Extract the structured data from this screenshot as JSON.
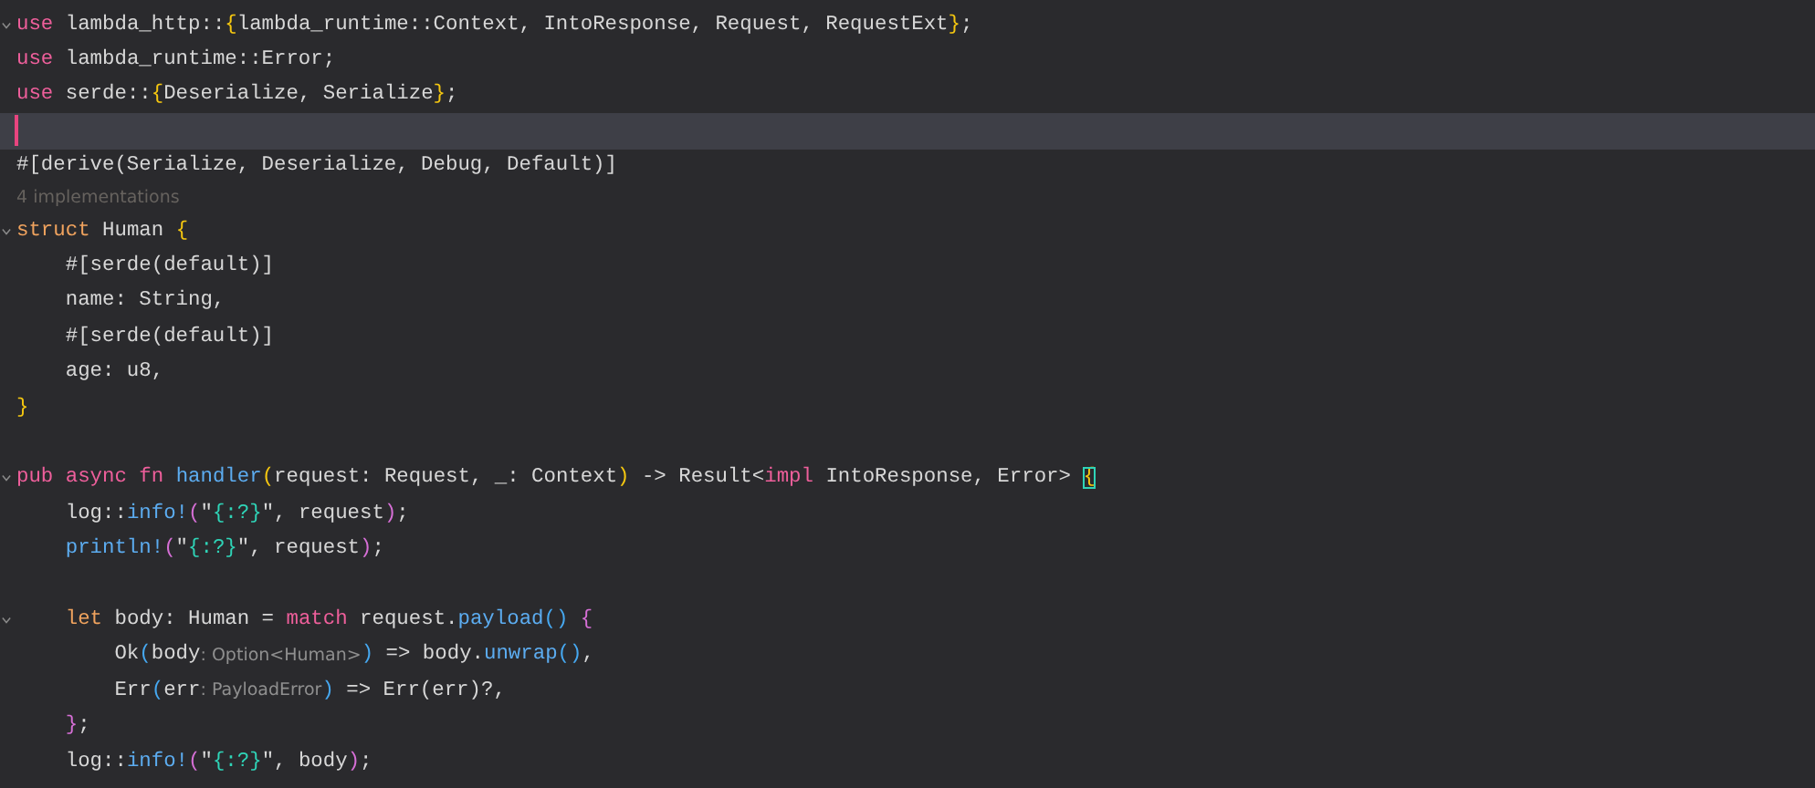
{
  "editor": {
    "lines": [
      {
        "kind": "code",
        "foldable": true,
        "current": false,
        "tokens": [
          {
            "text": "use",
            "kind": "keyword"
          },
          {
            "text": " lambda_http::",
            "kind": "plain"
          },
          {
            "text": "{",
            "kind": "bracket-yellow"
          },
          {
            "text": "lambda_runtime::Context, IntoResponse, Request, RequestExt",
            "kind": "plain"
          },
          {
            "text": "}",
            "kind": "bracket-yellow"
          },
          {
            "text": ";",
            "kind": "plain"
          }
        ]
      },
      {
        "kind": "code",
        "foldable": false,
        "current": false,
        "tokens": [
          {
            "text": "use",
            "kind": "keyword"
          },
          {
            "text": " lambda_runtime::Error;",
            "kind": "plain"
          }
        ]
      },
      {
        "kind": "code",
        "foldable": false,
        "current": false,
        "tokens": [
          {
            "text": "use",
            "kind": "keyword"
          },
          {
            "text": " serde::",
            "kind": "plain"
          },
          {
            "text": "{",
            "kind": "bracket-yellow"
          },
          {
            "text": "Deserialize, Serialize",
            "kind": "plain"
          },
          {
            "text": "}",
            "kind": "bracket-yellow"
          },
          {
            "text": ";",
            "kind": "plain"
          }
        ]
      },
      {
        "kind": "code",
        "foldable": false,
        "current": true
      },
      {
        "kind": "code",
        "foldable": false,
        "current": false,
        "tokens": [
          {
            "text": "#[derive(Serialize, Deserialize, Debug, Default)]",
            "kind": "plain"
          }
        ]
      },
      {
        "kind": "lens",
        "text": "4 implementations"
      },
      {
        "kind": "code",
        "foldable": true,
        "current": false,
        "tokens": [
          {
            "text": "struct",
            "kind": "declaration"
          },
          {
            "text": " Human ",
            "kind": "plain"
          },
          {
            "text": "{",
            "kind": "bracket-yellow"
          }
        ]
      },
      {
        "kind": "code",
        "foldable": false,
        "current": false,
        "tokens": [
          {
            "text": "    #[serde(default)]",
            "kind": "plain"
          }
        ]
      },
      {
        "kind": "code",
        "foldable": false,
        "current": false,
        "tokens": [
          {
            "text": "    name: String,",
            "kind": "plain"
          }
        ]
      },
      {
        "kind": "code",
        "foldable": false,
        "current": false,
        "tokens": [
          {
            "text": "    #[serde(default)]",
            "kind": "plain"
          }
        ]
      },
      {
        "kind": "code",
        "foldable": false,
        "current": false,
        "tokens": [
          {
            "text": "    age: u8,",
            "kind": "plain"
          }
        ]
      },
      {
        "kind": "code",
        "foldable": false,
        "current": false,
        "tokens": [
          {
            "text": "}",
            "kind": "bracket-yellow"
          }
        ]
      },
      {
        "kind": "code",
        "foldable": false,
        "current": false
      },
      {
        "kind": "code",
        "foldable": true,
        "current": false,
        "tokens": [
          {
            "text": "pub ",
            "kind": "keyword"
          },
          {
            "text": "async ",
            "kind": "keyword"
          },
          {
            "text": "fn ",
            "kind": "keyword"
          },
          {
            "text": "handler",
            "kind": "function"
          },
          {
            "text": "(",
            "kind": "bracket-yellow"
          },
          {
            "text": "request: Request, _: Context",
            "kind": "plain"
          },
          {
            "text": ")",
            "kind": "bracket-yellow"
          },
          {
            "text": " -> Result<",
            "kind": "plain"
          },
          {
            "text": "impl",
            "kind": "keyword"
          },
          {
            "text": " IntoResponse, Error> ",
            "kind": "plain"
          },
          {
            "text": "{",
            "kind": "bracket-matched"
          }
        ]
      },
      {
        "kind": "code",
        "foldable": false,
        "current": false,
        "tokens": [
          {
            "text": "    log::",
            "kind": "plain"
          },
          {
            "text": "info!",
            "kind": "function"
          },
          {
            "text": "(",
            "kind": "bracket-pink"
          },
          {
            "text": "\"",
            "kind": "plain"
          },
          {
            "text": "{:?}",
            "kind": "string"
          },
          {
            "text": "\", request",
            "kind": "plain"
          },
          {
            "text": ")",
            "kind": "bracket-pink"
          },
          {
            "text": ";",
            "kind": "plain"
          }
        ]
      },
      {
        "kind": "code",
        "foldable": false,
        "current": false,
        "tokens": [
          {
            "text": "    println!",
            "kind": "function"
          },
          {
            "text": "(",
            "kind": "bracket-pink"
          },
          {
            "text": "\"",
            "kind": "plain"
          },
          {
            "text": "{:?}",
            "kind": "string"
          },
          {
            "text": "\", request",
            "kind": "plain"
          },
          {
            "text": ")",
            "kind": "bracket-pink"
          },
          {
            "text": ";",
            "kind": "plain"
          }
        ]
      },
      {
        "kind": "code",
        "foldable": false,
        "current": false
      },
      {
        "kind": "code",
        "foldable": true,
        "current": false,
        "tokens": [
          {
            "text": "    let",
            "kind": "declaration"
          },
          {
            "text": " body: Human = ",
            "kind": "plain"
          },
          {
            "text": "match",
            "kind": "keyword"
          },
          {
            "text": " request.",
            "kind": "plain"
          },
          {
            "text": "payload",
            "kind": "function"
          },
          {
            "text": "()",
            "kind": "bracket-blue"
          },
          {
            "text": " {",
            "kind": "bracket-pink"
          }
        ]
      },
      {
        "kind": "code",
        "foldable": false,
        "current": false,
        "tokens": [
          {
            "text": "        Ok",
            "kind": "plain"
          },
          {
            "text": "(",
            "kind": "bracket-blue"
          },
          {
            "text": "body",
            "kind": "plain"
          },
          {
            "text": ": Option<Human>",
            "kind": "hint"
          },
          {
            "text": ")",
            "kind": "bracket-blue"
          },
          {
            "text": " => body.",
            "kind": "plain"
          },
          {
            "text": "unwrap",
            "kind": "function"
          },
          {
            "text": "()",
            "kind": "bracket-blue"
          },
          {
            "text": ",",
            "kind": "plain"
          }
        ]
      },
      {
        "kind": "code",
        "foldable": false,
        "current": false,
        "tokens": [
          {
            "text": "        Err",
            "kind": "plain"
          },
          {
            "text": "(",
            "kind": "bracket-blue"
          },
          {
            "text": "err",
            "kind": "plain"
          },
          {
            "text": ": PayloadError",
            "kind": "hint"
          },
          {
            "text": ")",
            "kind": "bracket-blue"
          },
          {
            "text": " => Err(err)?,",
            "kind": "plain"
          }
        ]
      },
      {
        "kind": "code",
        "foldable": false,
        "current": false,
        "tokens": [
          {
            "text": "    }",
            "kind": "bracket-pink"
          },
          {
            "text": ";",
            "kind": "plain"
          }
        ]
      },
      {
        "kind": "code",
        "foldable": false,
        "current": false,
        "tokens": [
          {
            "text": "    log::",
            "kind": "plain"
          },
          {
            "text": "info!",
            "kind": "function"
          },
          {
            "text": "(",
            "kind": "bracket-pink"
          },
          {
            "text": "\"",
            "kind": "plain"
          },
          {
            "text": "{:?}",
            "kind": "string"
          },
          {
            "text": "\", body",
            "kind": "plain"
          },
          {
            "text": ")",
            "kind": "bracket-pink"
          },
          {
            "text": ";",
            "kind": "plain"
          }
        ]
      }
    ]
  }
}
